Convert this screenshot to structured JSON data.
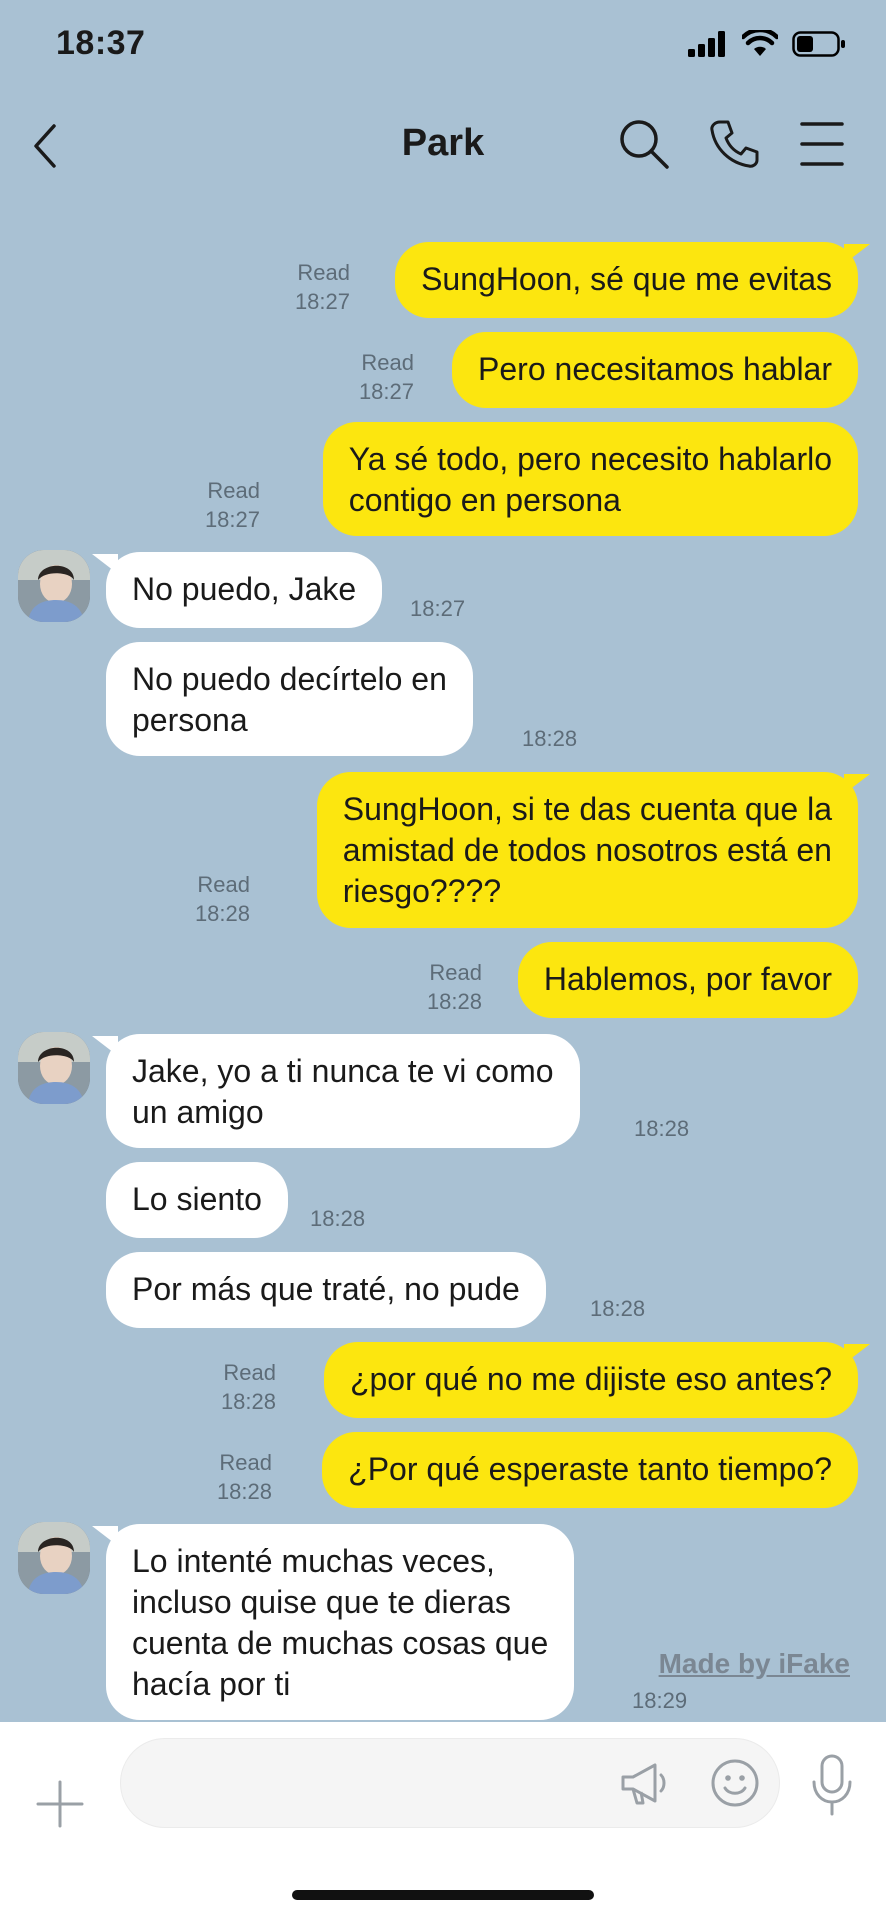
{
  "status": {
    "time": "18:37"
  },
  "header": {
    "title": "Park"
  },
  "messages": [
    {
      "text": "SungHoon, sé que me evitas",
      "read": "Read",
      "time": "18:27"
    },
    {
      "text": "Pero necesitamos hablar",
      "read": "Read",
      "time": "18:27"
    },
    {
      "text": "Ya sé todo, pero necesito hablarlo\ncontigo en persona",
      "read": "Read",
      "time": "18:27"
    },
    {
      "text": "No puedo, Jake",
      "time": "18:27"
    },
    {
      "text": "No puedo decírtelo en\npersona",
      "time": "18:28"
    },
    {
      "text": "SungHoon, si te das cuenta que la\namistad de todos nosotros está en\nriesgo????",
      "read": "Read",
      "time": "18:28"
    },
    {
      "text": "Hablemos, por favor",
      "read": "Read",
      "time": "18:28"
    },
    {
      "text": "Jake, yo a ti nunca te vi como\nun amigo",
      "time": "18:28"
    },
    {
      "text": "Lo siento",
      "time": "18:28"
    },
    {
      "text": "Por más que traté, no pude",
      "time": "18:28"
    },
    {
      "text": "¿por qué no me dijiste eso antes?",
      "read": "Read",
      "time": "18:28"
    },
    {
      "text": "¿Por qué esperaste tanto tiempo?",
      "read": "Read",
      "time": "18:28"
    },
    {
      "text": "Lo intenté muchas veces,\nincluso quise que te dieras\ncuenta de muchas cosas que\nhacía por ti",
      "time": "18:29"
    }
  ],
  "watermark": "Made by iFake",
  "input": {
    "placeholder": ""
  },
  "icons": [
    "back-icon",
    "search-icon",
    "phone-icon",
    "menu-icon",
    "plus-icon",
    "megaphone-icon",
    "emoji-icon",
    "microphone-icon"
  ]
}
